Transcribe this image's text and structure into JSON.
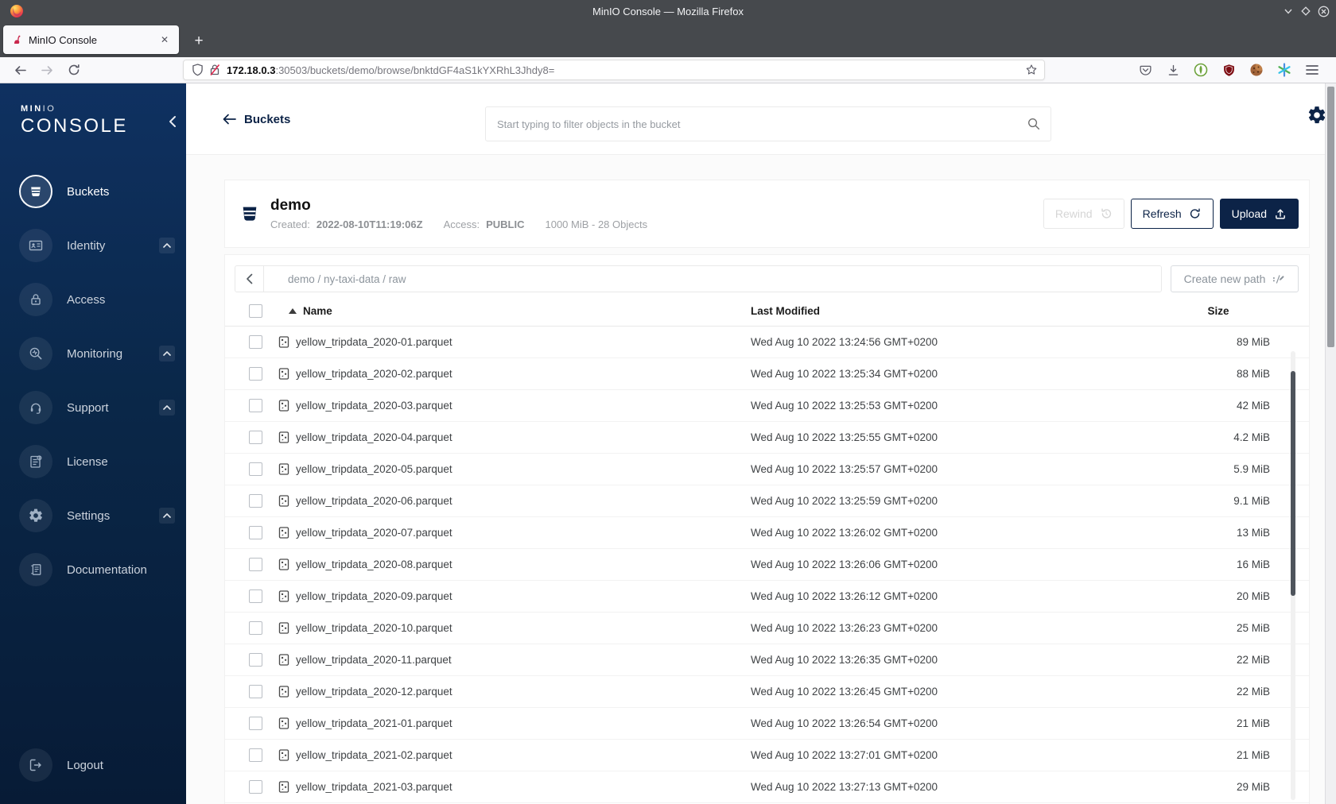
{
  "window": {
    "title": "MinIO Console — Mozilla Firefox"
  },
  "browser": {
    "tab_title": "MinIO Console",
    "url_host": "172.18.0.3",
    "url_rest": ":30503/buckets/demo/browse/bnktdGF4aS1kYXRhL3Jhdy8=",
    "new_tab_label": "+",
    "tab_close_label": "✕"
  },
  "sidebar": {
    "brand_bold": "MIN",
    "brand_light": "IO",
    "product": "CONSOLE",
    "items": [
      {
        "label": "Buckets",
        "icon": "bucket-icon",
        "active": true,
        "expandable": false
      },
      {
        "label": "Identity",
        "icon": "identity-card-icon",
        "active": false,
        "expandable": true
      },
      {
        "label": "Access",
        "icon": "lock-icon",
        "active": false,
        "expandable": false
      },
      {
        "label": "Monitoring",
        "icon": "magnifier-pulse-icon",
        "active": false,
        "expandable": true
      },
      {
        "label": "Support",
        "icon": "headset-icon",
        "active": false,
        "expandable": true
      },
      {
        "label": "License",
        "icon": "license-doc-icon",
        "active": false,
        "expandable": false
      },
      {
        "label": "Settings",
        "icon": "gear-icon",
        "active": false,
        "expandable": true
      },
      {
        "label": "Documentation",
        "icon": "book-icon",
        "active": false,
        "expandable": false
      }
    ],
    "logout_label": "Logout"
  },
  "header": {
    "back_label": "Buckets",
    "search_placeholder": "Start typing to filter objects in the bucket"
  },
  "bucket": {
    "name": "demo",
    "created_label": "Created:",
    "created_value": "2022-08-10T11:19:06Z",
    "access_label": "Access:",
    "access_value": "PUBLIC",
    "summary": "1000 MiB - 28 Objects",
    "rewind_label": "Rewind",
    "refresh_label": "Refresh",
    "upload_label": "Upload"
  },
  "pathbar": {
    "breadcrumb": "demo / ny-taxi-data / raw",
    "create_path_label": "Create new path"
  },
  "table": {
    "columns": {
      "name": "Name",
      "modified": "Last Modified",
      "size": "Size"
    },
    "rows": [
      {
        "name": "yellow_tripdata_2020-01.parquet",
        "modified": "Wed Aug 10 2022 13:24:56 GMT+0200",
        "size": "89 MiB"
      },
      {
        "name": "yellow_tripdata_2020-02.parquet",
        "modified": "Wed Aug 10 2022 13:25:34 GMT+0200",
        "size": "88 MiB"
      },
      {
        "name": "yellow_tripdata_2020-03.parquet",
        "modified": "Wed Aug 10 2022 13:25:53 GMT+0200",
        "size": "42 MiB"
      },
      {
        "name": "yellow_tripdata_2020-04.parquet",
        "modified": "Wed Aug 10 2022 13:25:55 GMT+0200",
        "size": "4.2 MiB"
      },
      {
        "name": "yellow_tripdata_2020-05.parquet",
        "modified": "Wed Aug 10 2022 13:25:57 GMT+0200",
        "size": "5.9 MiB"
      },
      {
        "name": "yellow_tripdata_2020-06.parquet",
        "modified": "Wed Aug 10 2022 13:25:59 GMT+0200",
        "size": "9.1 MiB"
      },
      {
        "name": "yellow_tripdata_2020-07.parquet",
        "modified": "Wed Aug 10 2022 13:26:02 GMT+0200",
        "size": "13 MiB"
      },
      {
        "name": "yellow_tripdata_2020-08.parquet",
        "modified": "Wed Aug 10 2022 13:26:06 GMT+0200",
        "size": "16 MiB"
      },
      {
        "name": "yellow_tripdata_2020-09.parquet",
        "modified": "Wed Aug 10 2022 13:26:12 GMT+0200",
        "size": "20 MiB"
      },
      {
        "name": "yellow_tripdata_2020-10.parquet",
        "modified": "Wed Aug 10 2022 13:26:23 GMT+0200",
        "size": "25 MiB"
      },
      {
        "name": "yellow_tripdata_2020-11.parquet",
        "modified": "Wed Aug 10 2022 13:26:35 GMT+0200",
        "size": "22 MiB"
      },
      {
        "name": "yellow_tripdata_2020-12.parquet",
        "modified": "Wed Aug 10 2022 13:26:45 GMT+0200",
        "size": "22 MiB"
      },
      {
        "name": "yellow_tripdata_2021-01.parquet",
        "modified": "Wed Aug 10 2022 13:26:54 GMT+0200",
        "size": "21 MiB"
      },
      {
        "name": "yellow_tripdata_2021-02.parquet",
        "modified": "Wed Aug 10 2022 13:27:01 GMT+0200",
        "size": "21 MiB"
      },
      {
        "name": "yellow_tripdata_2021-03.parquet",
        "modified": "Wed Aug 10 2022 13:27:13 GMT+0200",
        "size": "29 MiB"
      }
    ]
  },
  "colors": {
    "navy": "#0c2347",
    "sidebar_top": "#0f3161",
    "sidebar_bottom": "#071b36",
    "chrome_dark": "#46494d",
    "toolbar_light": "#f9f9fb",
    "ublock_red": "#7d0c12",
    "badger_green": "#6ca23b"
  }
}
